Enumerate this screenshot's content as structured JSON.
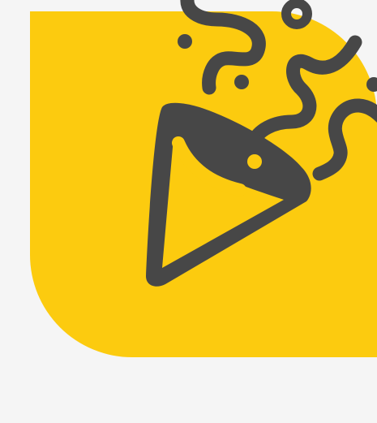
{
  "illustration": {
    "icon": "party-popper-icon",
    "colors": {
      "background": "#f5f5f5",
      "tile": "#fccb0f",
      "ink": "#474747"
    }
  }
}
